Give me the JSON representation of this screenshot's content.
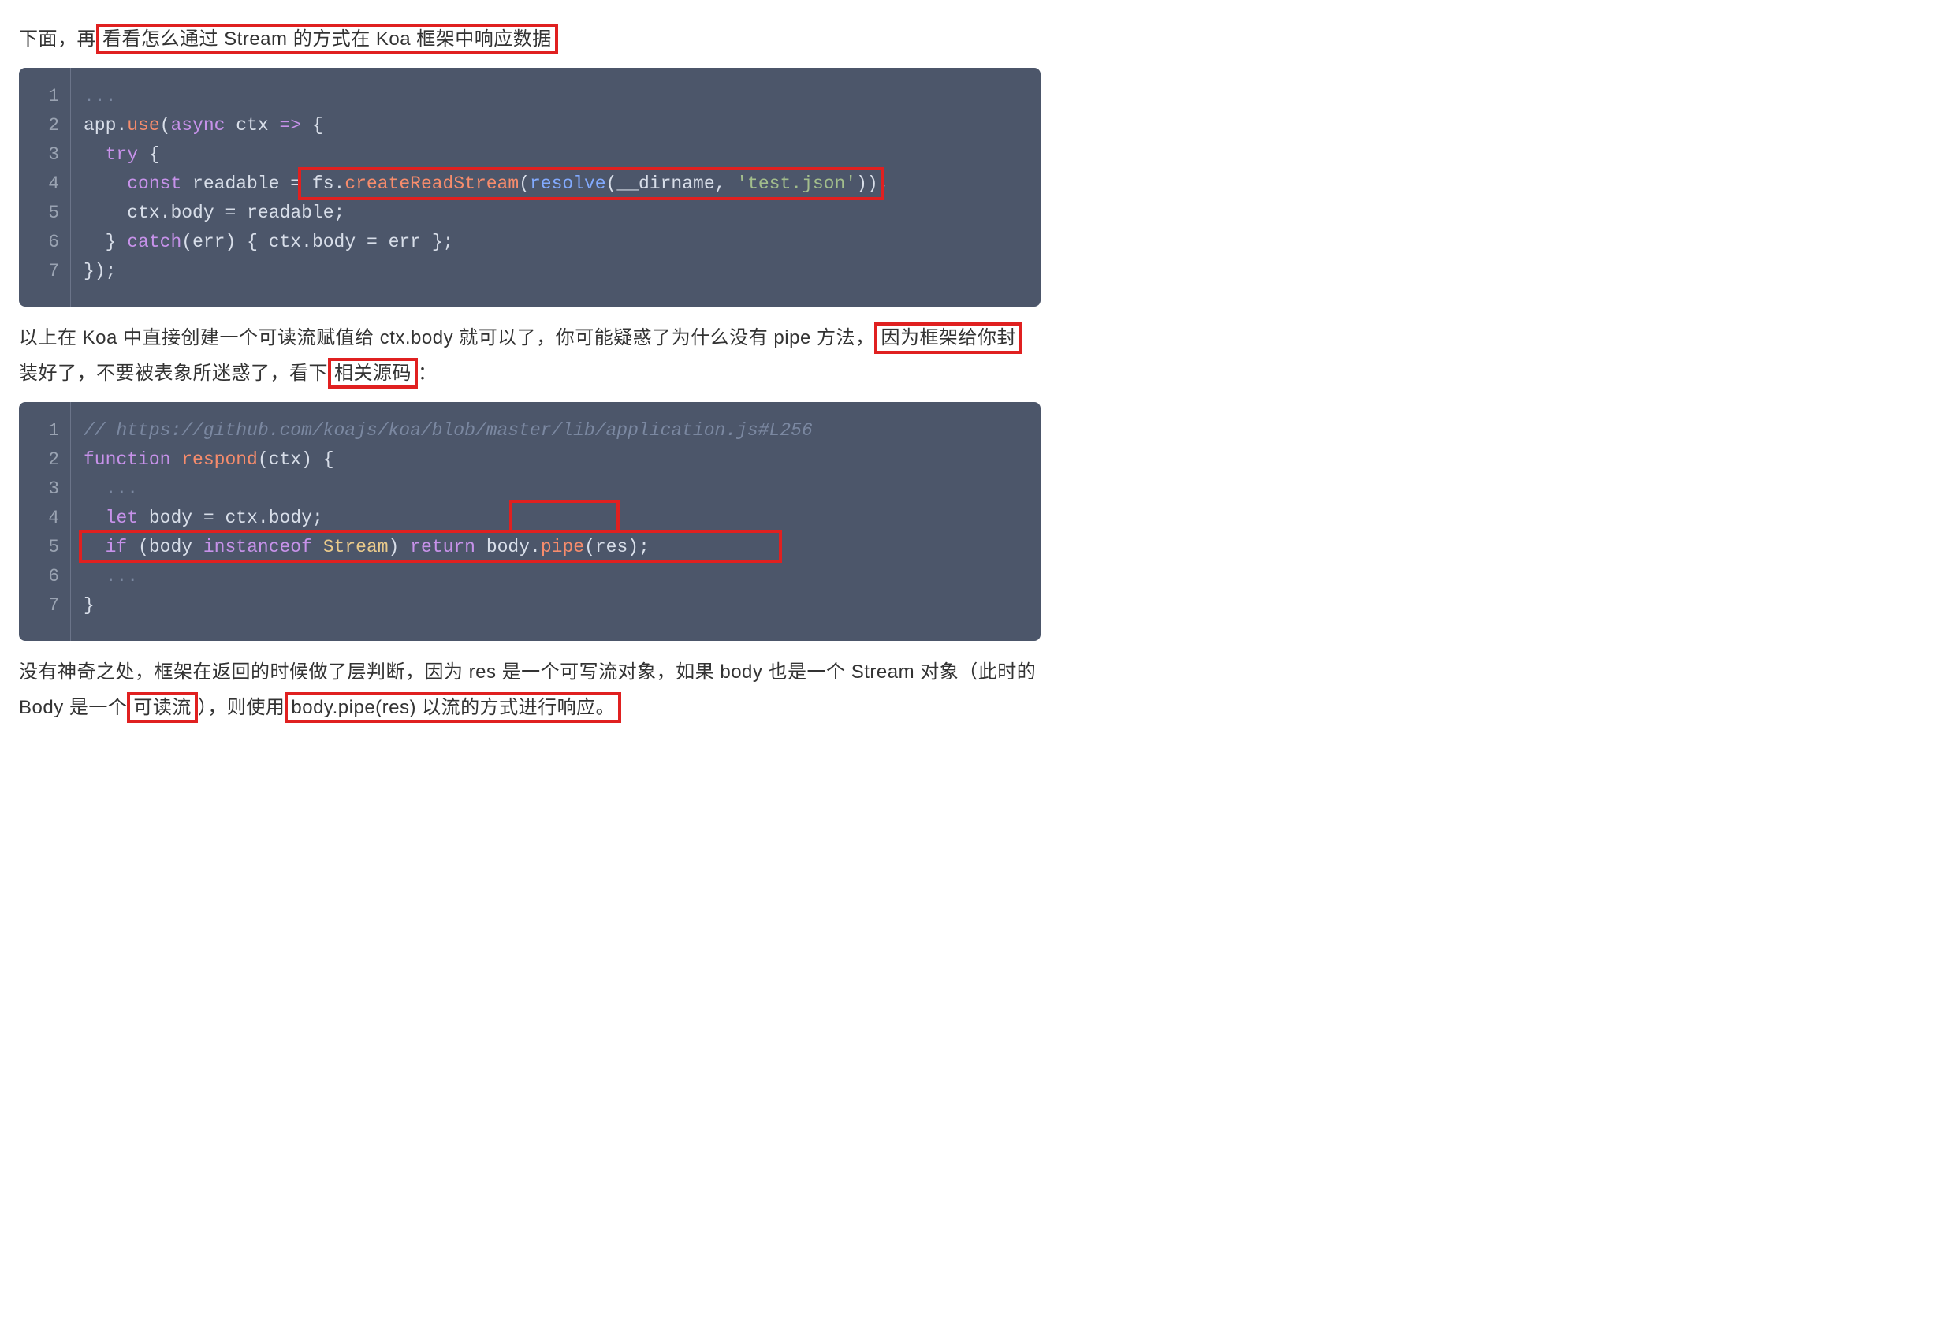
{
  "para1": {
    "pre": "下面，再",
    "hl": "看看怎么通过 Stream 的方式在 Koa 框架中响应数据",
    "post": ""
  },
  "code1": {
    "lines": [
      "1",
      "2",
      "3",
      "4",
      "5",
      "6",
      "7"
    ],
    "l1_dots": "...",
    "l2_app": "app",
    "l2_use": "use",
    "l2_async": "async",
    "l2_ctx": "ctx",
    "l2_arrow": "=>",
    "l3_try": "try",
    "l4_const": "const",
    "l4_readable": "readable",
    "l4_eq": "=",
    "l4_fs": "fs",
    "l4_create": "createReadStream",
    "l4_resolve": "resolve",
    "l4_dirname": "__dirname",
    "l4_str": "'test.json'",
    "l5_ctx": "ctx",
    "l5_body": "body",
    "l5_readable": "readable",
    "l6_catch": "catch",
    "l6_err": "err",
    "l6_ctx": "ctx",
    "l6_body": "body",
    "l6_err2": "err",
    "l7_close": "});"
  },
  "para2": {
    "seg1": "以上在 Koa 中直接创建一个可读流赋值给 ctx.body 就可以了，你可能疑惑了为什么没有 pipe 方法，",
    "hl1": "因为框架给你封",
    "seg2": "装好了，不要被表象所迷惑了，看下",
    "hl2": "相关源码",
    "seg3": "："
  },
  "code2": {
    "lines": [
      "1",
      "2",
      "3",
      "4",
      "5",
      "6",
      "7"
    ],
    "l1_cmt": "// https://github.com/koajs/koa/blob/master/lib/application.js#L256",
    "l2_fn": "function",
    "l2_resp": "respond",
    "l2_ctx": "ctx",
    "l3_dots": "...",
    "l4_let": "let",
    "l4_body": "body",
    "l4_ctx": "ctx",
    "l4_body2": "body",
    "l5_if": "if",
    "l5_body": "body",
    "l5_inst": "instanceof",
    "l5_stream": "Stream",
    "l5_ret": "return",
    "l5_body2": "body",
    "l5_pipe": "pipe",
    "l5_res": "res",
    "l6_dots": "...",
    "l7_close": "}"
  },
  "para3": {
    "seg1": "没有神奇之处，框架在返回的时候做了层判断，因为 res 是一个可写流对象，如果 body 也是一个 Stream 对象（此时的 Body 是一个",
    "hl1": "可读流",
    "seg2": "），则使用",
    "hl2": " body.pipe(res) 以流的方式进行响应。",
    "seg3": ""
  }
}
